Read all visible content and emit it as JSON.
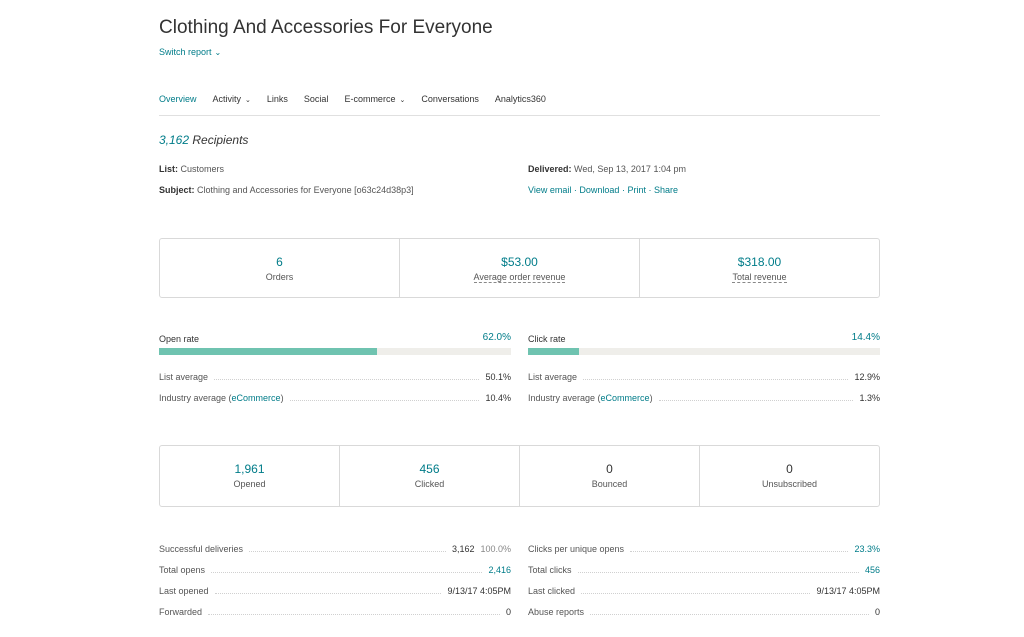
{
  "header": {
    "title": "Clothing And Accessories For Everyone",
    "switch_report": "Switch report"
  },
  "tabs": [
    {
      "label": "Overview",
      "active": true,
      "dropdown": false
    },
    {
      "label": "Activity",
      "active": false,
      "dropdown": true
    },
    {
      "label": "Links",
      "active": false,
      "dropdown": false
    },
    {
      "label": "Social",
      "active": false,
      "dropdown": false
    },
    {
      "label": "E-commerce",
      "active": false,
      "dropdown": true
    },
    {
      "label": "Conversations",
      "active": false,
      "dropdown": false
    },
    {
      "label": "Analytics360",
      "active": false,
      "dropdown": false
    }
  ],
  "summary": {
    "recipients_count": "3,162",
    "recipients_label": "Recipients",
    "list_label": "List:",
    "list_value": "Customers",
    "subject_label": "Subject:",
    "subject_value": "Clothing and Accessories for Everyone [o63c24d38p3]",
    "delivered_label": "Delivered:",
    "delivered_value": "Wed, Sep 13, 2017 1:04 pm",
    "actions": [
      "View email",
      "Download",
      "Print",
      "Share"
    ],
    "action_separator": "·"
  },
  "ecommerce": {
    "orders_value": "6",
    "orders_label": "Orders",
    "aor_value": "$53.00",
    "aor_label": "Average order revenue",
    "revenue_value": "$318.00",
    "revenue_label": "Total revenue"
  },
  "open_rate": {
    "label": "Open rate",
    "value": "62.0%",
    "fill_fraction": 0.62,
    "list_avg_label": "List average",
    "list_avg_value": "50.1%",
    "industry_label": "Industry average (",
    "industry_link": "eCommerce",
    "industry_close": ")",
    "industry_value": "10.4%"
  },
  "click_rate": {
    "label": "Click rate",
    "value": "14.4%",
    "fill_fraction": 0.144,
    "list_avg_label": "List average",
    "list_avg_value": "12.9%",
    "industry_label": "Industry average (",
    "industry_link": "eCommerce",
    "industry_close": ")",
    "industry_value": "1.3%"
  },
  "counts": {
    "opened_value": "1,961",
    "opened_label": "Opened",
    "clicked_value": "456",
    "clicked_label": "Clicked",
    "bounced_value": "0",
    "bounced_label": "Bounced",
    "unsub_value": "0",
    "unsub_label": "Unsubscribed"
  },
  "left_stats": [
    {
      "label": "Successful deliveries",
      "value": "3,162",
      "sub": "100.0%",
      "link": false
    },
    {
      "label": "Total opens",
      "value": "2,416",
      "sub": "",
      "link": true
    },
    {
      "label": "Last opened",
      "value": "9/13/17 4:05PM",
      "sub": "",
      "link": false
    },
    {
      "label": "Forwarded",
      "value": "0",
      "sub": "",
      "link": false
    }
  ],
  "right_stats": [
    {
      "label": "Clicks per unique opens",
      "value": "23.3%",
      "link": true
    },
    {
      "label": "Total clicks",
      "value": "456",
      "link": true
    },
    {
      "label": "Last clicked",
      "value": "9/13/17 4:05PM",
      "link": false
    },
    {
      "label": "Abuse reports",
      "value": "0",
      "link": false
    }
  ],
  "colors": {
    "accent": "#007c89",
    "bar_fill": "#6fc3b0",
    "bar_track": "#efeeea"
  }
}
